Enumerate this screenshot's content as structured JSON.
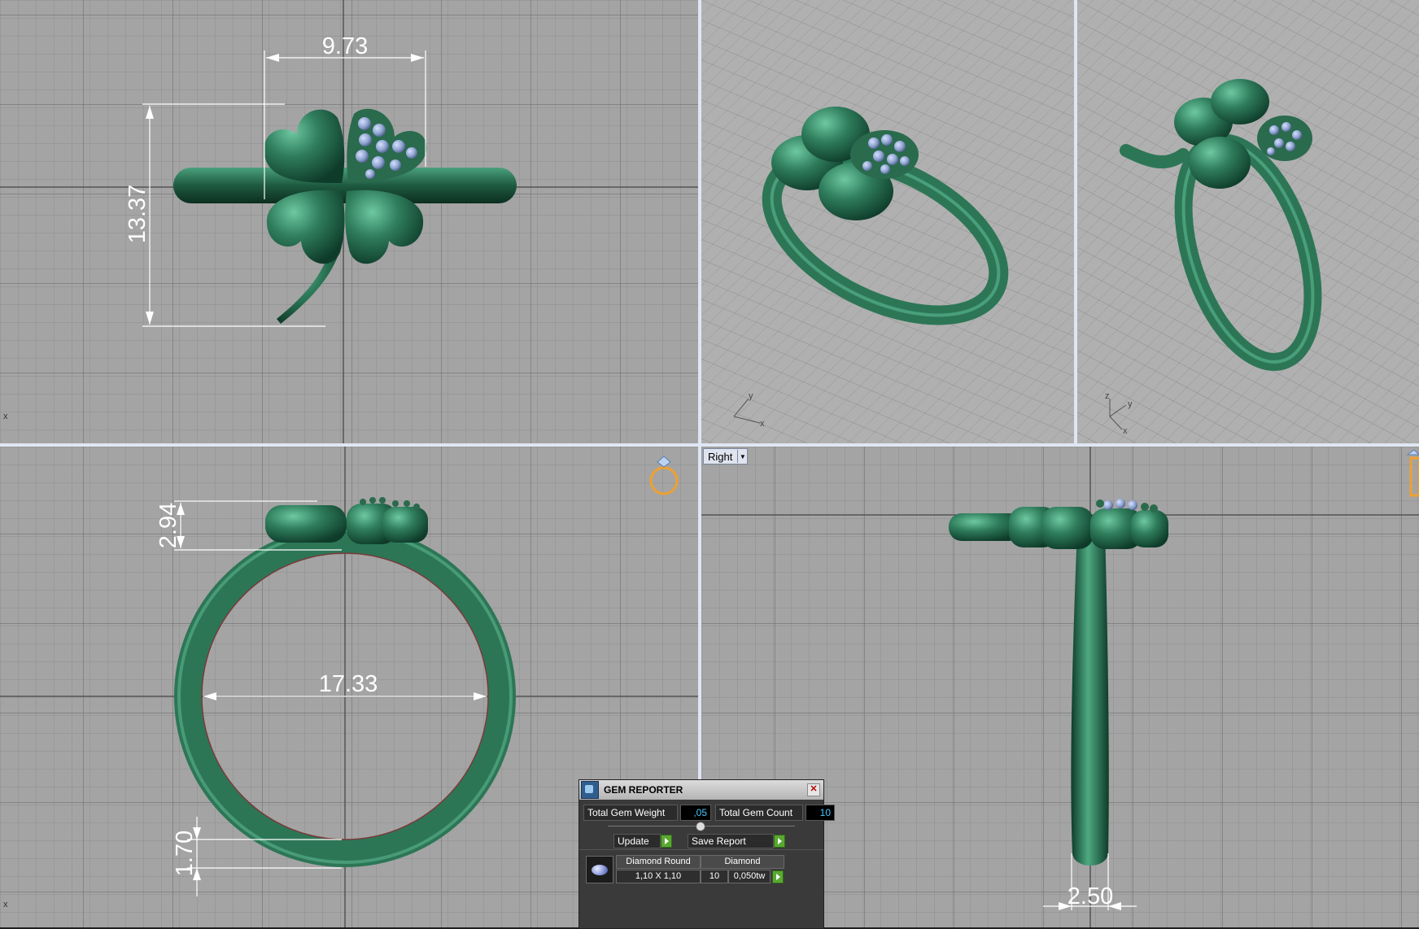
{
  "viewports": {
    "top_left": {
      "dims": {
        "width": "9.73",
        "height": "13.37"
      }
    },
    "bottom_left": {
      "dims": {
        "head_height": "2.94",
        "inner_diameter": "17.33",
        "band_thickness": "1.70"
      }
    },
    "bottom_right": {
      "view_label": "Right",
      "dims": {
        "band_width": "2.50"
      }
    },
    "axis_labels": {
      "x": "x",
      "y": "y",
      "z": "z"
    }
  },
  "gem_reporter": {
    "title": "GEM REPORTER",
    "total_weight_label": "Total Gem Weight",
    "total_weight_value": ",05",
    "total_count_label": "Total Gem Count",
    "total_count_value": "10",
    "update_label": "Update",
    "save_report_label": "Save Report",
    "table": {
      "headers": [
        "Diamond Round",
        "Diamond"
      ],
      "row": {
        "size": "1,10 X 1,10",
        "count": "10",
        "weight": "0,050tw"
      }
    }
  },
  "colors": {
    "viewport_bg": "#a4a4a4",
    "metal": "#2f7d5c",
    "gem": "#8fa4cf",
    "dimension_line": "#ffffff",
    "viewport_border": "#9fb4d8",
    "accent_orange": "#f0a030"
  },
  "icons": [
    "gem-reporter-icon",
    "close-icon",
    "play-arrow-icon",
    "gem-thumbnail-icon",
    "ring-view-icon",
    "dropdown-arrow-icon"
  ]
}
